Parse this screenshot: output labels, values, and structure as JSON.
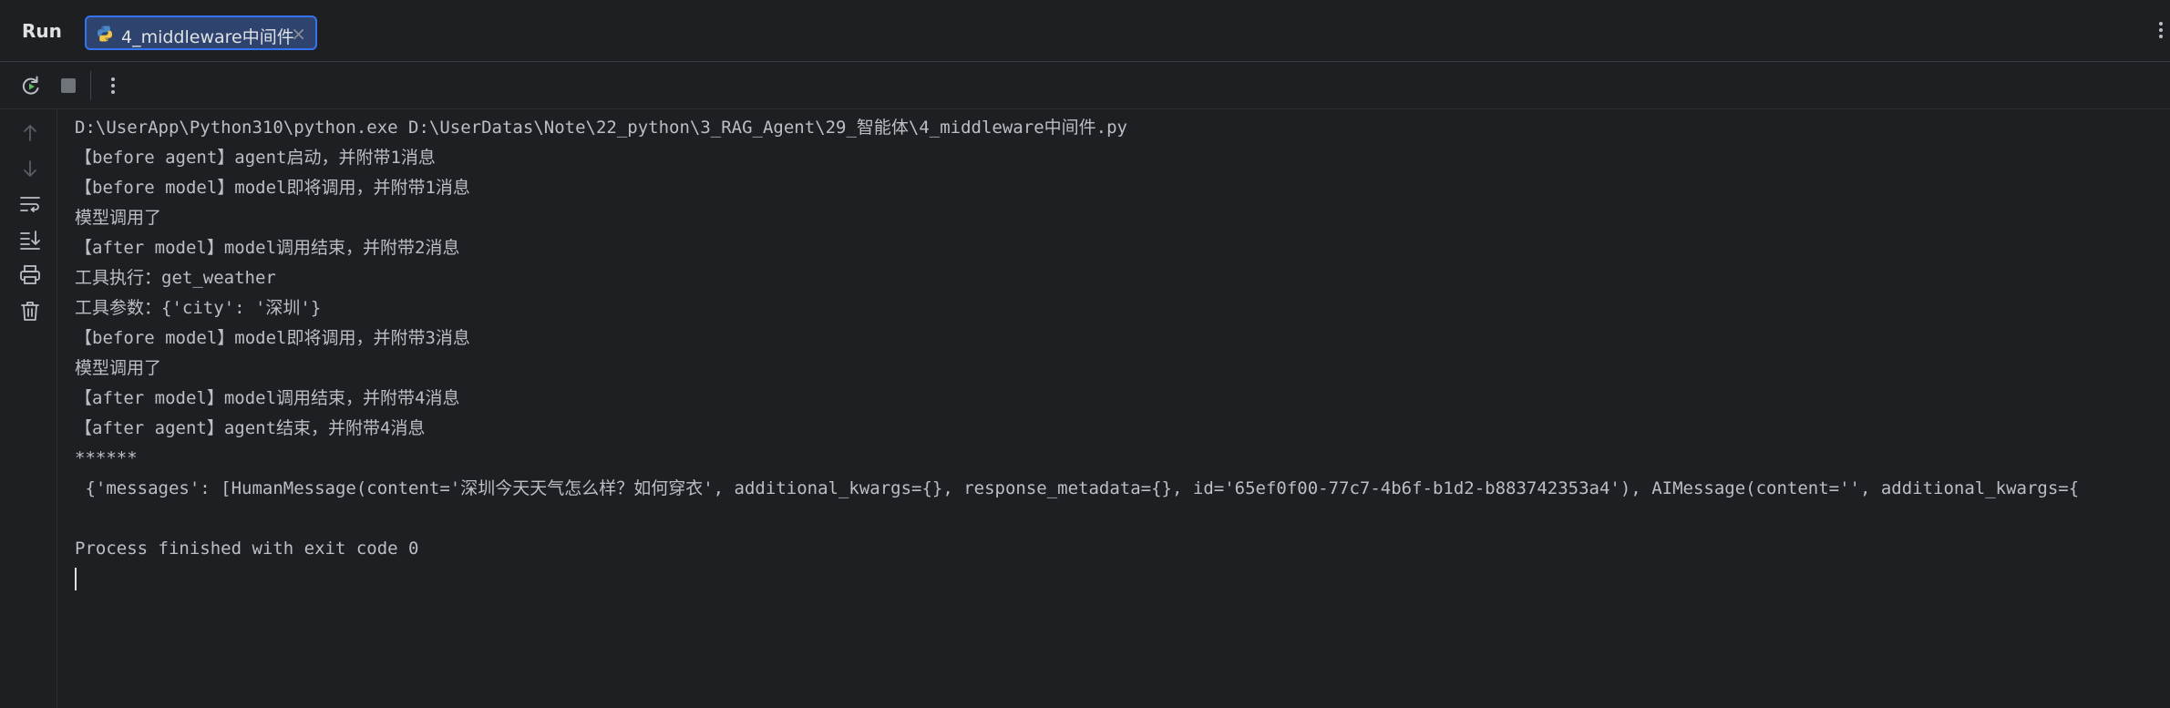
{
  "header": {
    "run_label": "Run",
    "tab_label": "4_middleware中间件",
    "tab_close": "×"
  },
  "icons": {
    "tab": "python-icon",
    "rerun": "rerun-icon",
    "stop": "stop-icon",
    "more": "more-vertical-icon",
    "up": "arrow-up-icon",
    "down": "arrow-down-icon",
    "soft_wrap": "soft-wrap-icon",
    "scroll_to_end": "scroll-to-end-icon",
    "print": "print-icon",
    "clear": "trash-icon"
  },
  "colors": {
    "background": "#1e1f22",
    "tab_bg": "#2e436e",
    "tab_border": "#3574f0",
    "text": "#bcbec4",
    "rerun_green": "#5fb865"
  },
  "console": {
    "lines": [
      "D:\\UserApp\\Python310\\python.exe D:\\UserDatas\\Note\\22_python\\3_RAG_Agent\\29_智能体\\4_middleware中间件.py",
      "【before agent】agent启动，并附带1消息",
      "【before model】model即将调用，并附带1消息",
      "模型调用了",
      "【after model】model调用结束，并附带2消息",
      "工具执行：get_weather",
      "工具参数：{'city': '深圳'}",
      "【before model】model即将调用，并附带3消息",
      "模型调用了",
      "【after model】model调用结束，并附带4消息",
      "【after agent】agent结束，并附带4消息",
      "******",
      " {'messages': [HumanMessage(content='深圳今天天气怎么样？如何穿衣', additional_kwargs={}, response_metadata={}, id='65ef0f00-77c7-4b6f-b1d2-b883742353a4'), AIMessage(content='', additional_kwargs={",
      "",
      "Process finished with exit code 0"
    ]
  }
}
